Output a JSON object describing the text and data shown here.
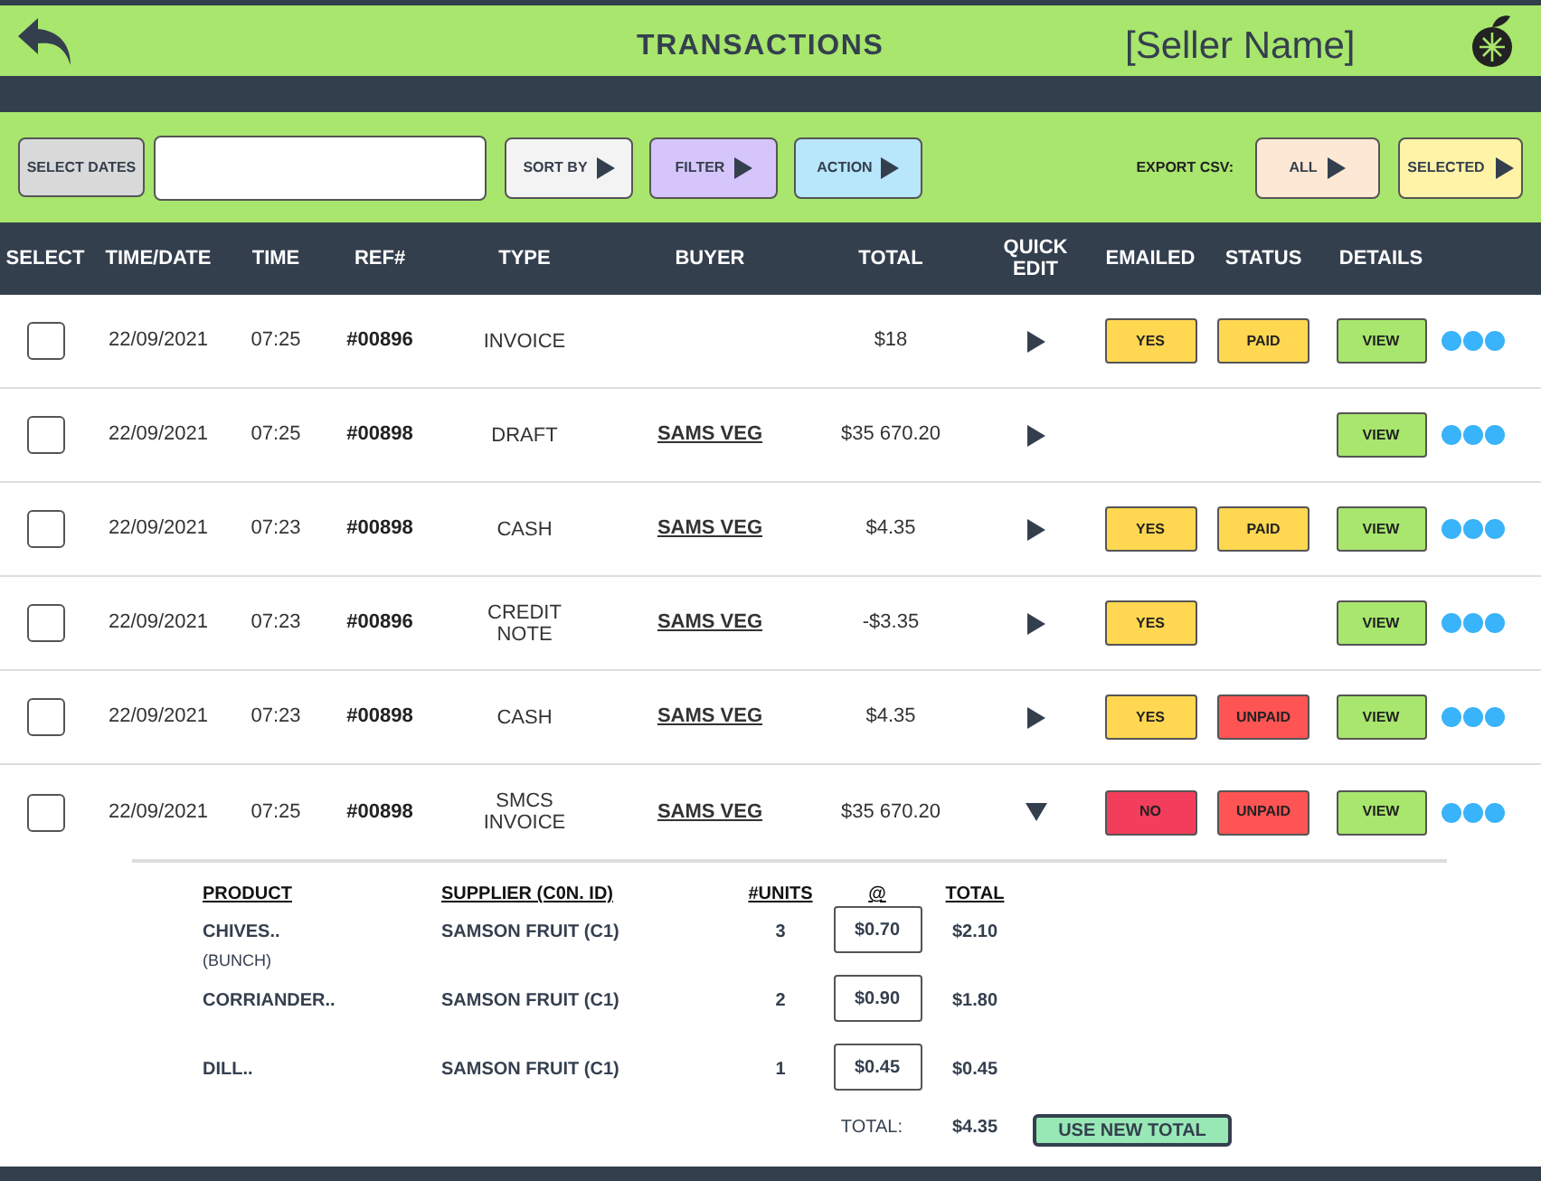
{
  "header": {
    "title": "TRANSACTIONS",
    "seller": "[Seller Name]"
  },
  "toolbar": {
    "date_button": "SELECT DATES",
    "buttons": [
      {
        "label": "SORT BY",
        "color": "#f3f3f3"
      },
      {
        "label": "FILTER",
        "color": "#d5c5fa"
      },
      {
        "label": "ACTION",
        "color": "#b8e6fa"
      }
    ],
    "export_label": "EXPORT CSV:",
    "export_buttons": [
      {
        "label": "ALL",
        "color": "#fde8d5"
      },
      {
        "label": "SELECTED",
        "color": "#fff3a8"
      }
    ]
  },
  "table": {
    "columns": [
      "SELECT",
      "TIME/DATE",
      "TIME",
      "REF#",
      "TYPE",
      "BUYER",
      "TOTAL",
      "QUICK EDIT",
      "EMAILED",
      "STATUS",
      "DETAILS"
    ],
    "rows": [
      {
        "checked": false,
        "date": "22/09/2021",
        "time": "07:25",
        "ref": "#00896",
        "type": "INVOICE",
        "total": "$18",
        "expanded": false,
        "emailed": {
          "label": "YES",
          "color": "#ffd751"
        },
        "status": {
          "label": "PAID",
          "color": "#ffd751"
        },
        "details": "VIEW"
      },
      {
        "checked": false,
        "date": "22/09/2021",
        "time": "07:25",
        "ref": "#00898",
        "type": "DRAFT",
        "buyer": "SAMS VEG",
        "total": "$35 670.20",
        "expanded": false,
        "details": "VIEW"
      },
      {
        "checked": false,
        "date": "22/09/2021",
        "time": "07:23",
        "ref": "#00898",
        "type": "CASH",
        "buyer": "SAMS VEG",
        "total": "$4.35",
        "expanded": false,
        "emailed": {
          "label": "YES",
          "color": "#ffd751"
        },
        "status": {
          "label": "PAID",
          "color": "#ffd751"
        },
        "details": "VIEW"
      },
      {
        "checked": false,
        "date": "22/09/2021",
        "time": "07:23",
        "ref": "#00896",
        "type": "CREDIT NOTE",
        "buyer": "SAMS VEG",
        "total": "-$3.35",
        "expanded": false,
        "emailed": {
          "label": "YES",
          "color": "#ffd751"
        },
        "details": "VIEW"
      },
      {
        "checked": false,
        "date": "22/09/2021",
        "time": "07:23",
        "ref": "#00898",
        "type": "CASH",
        "buyer": "SAMS VEG",
        "total": "$4.35",
        "expanded": false,
        "emailed": {
          "label": "YES",
          "color": "#ffd751"
        },
        "status": {
          "label": "UNPAID",
          "color": "#fe5454"
        },
        "details": "VIEW"
      },
      {
        "checked": false,
        "date": "22/09/2021",
        "time": "07:25",
        "ref": "#00898",
        "type": "SMCS INVOICE",
        "buyer": "SAMS VEG",
        "total": "$35 670.20",
        "expanded": true,
        "emailed": {
          "label": "NO",
          "color": "#f23e5c"
        },
        "status": {
          "label": "UNPAID",
          "color": "#fe5454"
        },
        "details": "VIEW"
      }
    ]
  },
  "line_items": {
    "columns": [
      "PRODUCT",
      "SUPPLIER (C0N. ID)",
      "#UNITS",
      "@",
      "TOTAL"
    ],
    "items": [
      {
        "product": "CHIVES..",
        "note": "(BUNCH)",
        "supplier": "SAMSON FRUIT (C1)",
        "units": "3",
        "price": "$0.70",
        "total": "$2.10"
      },
      {
        "product": "CORRIANDER..",
        "supplier": "SAMSON FRUIT (C1)",
        "units": "2",
        "price": "$0.90",
        "total": "$1.80"
      },
      {
        "product": "DILL..",
        "supplier": "SAMSON FRUIT (C1)",
        "units": "1",
        "price": "$0.45",
        "total": "$0.45"
      }
    ],
    "total_label": "TOTAL:",
    "total": "$4.35",
    "button": "USE NEW TOTAL"
  }
}
